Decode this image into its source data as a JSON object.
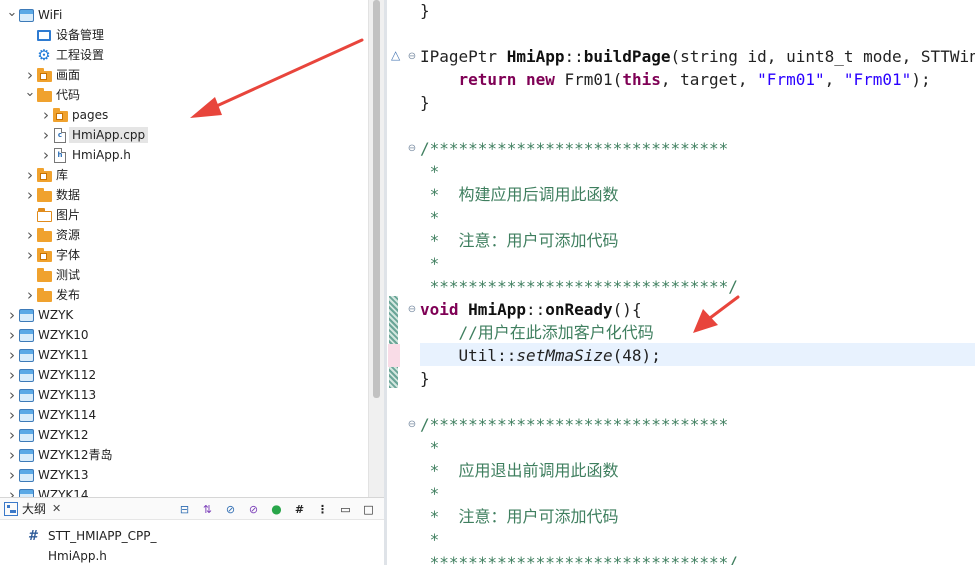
{
  "explorer": {
    "items": [
      {
        "label": "WiFi",
        "icon": "project-icon",
        "expand": "open"
      },
      {
        "label": "设备管理",
        "icon": "device-icon",
        "expand": "none"
      },
      {
        "label": "工程设置",
        "icon": "gear-icon",
        "expand": "none"
      },
      {
        "label": "画面",
        "icon": "folder-icon",
        "expand": "closed"
      },
      {
        "label": "代码",
        "icon": "folder-icon",
        "expand": "open"
      },
      {
        "label": "pages",
        "icon": "folder-icon",
        "expand": "closed"
      },
      {
        "label": "HmiApp.cpp",
        "icon": "cpp-file-icon",
        "expand": "closed",
        "selected": true
      },
      {
        "label": "HmiApp.h",
        "icon": "h-file-icon",
        "expand": "closed"
      },
      {
        "label": "库",
        "icon": "folder-icon",
        "expand": "closed"
      },
      {
        "label": "数据",
        "icon": "folder-icon",
        "expand": "closed"
      },
      {
        "label": "图片",
        "icon": "image-folder-icon",
        "expand": "none"
      },
      {
        "label": "资源",
        "icon": "folder-icon",
        "expand": "closed"
      },
      {
        "label": "字体",
        "icon": "folder-icon",
        "expand": "closed"
      },
      {
        "label": "测试",
        "icon": "folder-icon",
        "expand": "none"
      },
      {
        "label": "发布",
        "icon": "folder-icon",
        "expand": "closed"
      },
      {
        "label": "WZYK",
        "icon": "project-icon",
        "expand": "closed"
      },
      {
        "label": "WZYK10",
        "icon": "project-icon",
        "expand": "closed"
      },
      {
        "label": "WZYK11",
        "icon": "project-icon",
        "expand": "closed"
      },
      {
        "label": "WZYK112",
        "icon": "project-icon",
        "expand": "closed"
      },
      {
        "label": "WZYK113",
        "icon": "project-icon",
        "expand": "closed"
      },
      {
        "label": "WZYK114",
        "icon": "project-icon",
        "expand": "closed"
      },
      {
        "label": "WZYK12",
        "icon": "project-icon",
        "expand": "closed"
      },
      {
        "label": "WZYK12青岛",
        "icon": "project-icon",
        "expand": "closed"
      },
      {
        "label": "WZYK13",
        "icon": "project-icon",
        "expand": "closed"
      },
      {
        "label": "WZYK14",
        "icon": "project-icon",
        "expand": "closed"
      }
    ]
  },
  "outline": {
    "tab_label": "大纲",
    "close_glyph": "✕",
    "tools": [
      "collapse-all-icon",
      "sort-icon",
      "hide-fields-icon",
      "hide-static-icon",
      "green-dot-icon",
      "hash-icon",
      "view-menu-icon",
      "minimize-icon",
      "maximize-icon"
    ],
    "items": [
      {
        "prefix": "#",
        "label": "STT_HMIAPP_CPP_"
      },
      {
        "prefix": "",
        "label": "HmiApp.h"
      }
    ]
  },
  "editor": {
    "lines": [
      {
        "parts": [
          {
            "t": "}",
            "c": ""
          }
        ]
      },
      {
        "parts": []
      },
      {
        "parts": [
          {
            "t": "IPagePtr ",
            "c": ""
          },
          {
            "t": "HmiApp",
            "c": "fn"
          },
          {
            "t": "::",
            "c": ""
          },
          {
            "t": "buildPage",
            "c": "fn"
          },
          {
            "t": "(string id, uint8_t mode, STTWin",
            "c": ""
          }
        ]
      },
      {
        "parts": [
          {
            "t": "    ",
            "c": ""
          },
          {
            "t": "return",
            "c": "kw"
          },
          {
            "t": " ",
            "c": ""
          },
          {
            "t": "new",
            "c": "kw"
          },
          {
            "t": " Frm01(",
            "c": ""
          },
          {
            "t": "this",
            "c": "kw"
          },
          {
            "t": ", target, ",
            "c": ""
          },
          {
            "t": "\"Frm01\"",
            "c": "str"
          },
          {
            "t": ", ",
            "c": ""
          },
          {
            "t": "\"Frm01\"",
            "c": "str"
          },
          {
            "t": ");",
            "c": ""
          }
        ]
      },
      {
        "parts": [
          {
            "t": "}",
            "c": ""
          }
        ]
      },
      {
        "parts": []
      },
      {
        "parts": [
          {
            "t": "/*******************************",
            "c": "cmt"
          }
        ]
      },
      {
        "parts": [
          {
            "t": " *",
            "c": "cmt"
          }
        ]
      },
      {
        "parts": [
          {
            "t": " *  构建应用后调用此函数",
            "c": "cmt"
          }
        ]
      },
      {
        "parts": [
          {
            "t": " *",
            "c": "cmt"
          }
        ]
      },
      {
        "parts": [
          {
            "t": " *  注意：用户可添加代码",
            "c": "cmt"
          }
        ]
      },
      {
        "parts": [
          {
            "t": " *",
            "c": "cmt"
          }
        ]
      },
      {
        "parts": [
          {
            "t": " *******************************/",
            "c": "cmt"
          }
        ]
      },
      {
        "parts": [
          {
            "t": "void",
            "c": "kw"
          },
          {
            "t": " ",
            "c": ""
          },
          {
            "t": "HmiApp",
            "c": "fn"
          },
          {
            "t": "::",
            "c": ""
          },
          {
            "t": "onReady",
            "c": "fn"
          },
          {
            "t": "(){",
            "c": ""
          }
        ]
      },
      {
        "parts": [
          {
            "t": "    //用户在此添加客户化代码",
            "c": "cmt"
          }
        ]
      },
      {
        "parts": [
          {
            "t": "    Util::",
            "c": ""
          },
          {
            "t": "setMmaSize",
            "c": "it"
          },
          {
            "t": "(48);",
            "c": ""
          }
        ]
      },
      {
        "parts": [
          {
            "t": "}",
            "c": ""
          }
        ]
      },
      {
        "parts": []
      },
      {
        "parts": [
          {
            "t": "/*******************************",
            "c": "cmt"
          }
        ]
      },
      {
        "parts": [
          {
            "t": " *",
            "c": "cmt"
          }
        ]
      },
      {
        "parts": [
          {
            "t": " *  应用退出前调用此函数",
            "c": "cmt"
          }
        ]
      },
      {
        "parts": [
          {
            "t": " *",
            "c": "cmt"
          }
        ]
      },
      {
        "parts": [
          {
            "t": " *  注意：用户可添加代码",
            "c": "cmt"
          }
        ]
      },
      {
        "parts": [
          {
            "t": " *",
            "c": "cmt"
          }
        ]
      },
      {
        "parts": [
          {
            "t": " *******************************/",
            "c": "cmt"
          }
        ]
      }
    ]
  },
  "colors": {
    "comment": "#3f7f5f",
    "keyword": "#7f0055",
    "string": "#2a00ff",
    "annotation_arrow": "#e8453c",
    "current_line": "#e8f2fe"
  }
}
